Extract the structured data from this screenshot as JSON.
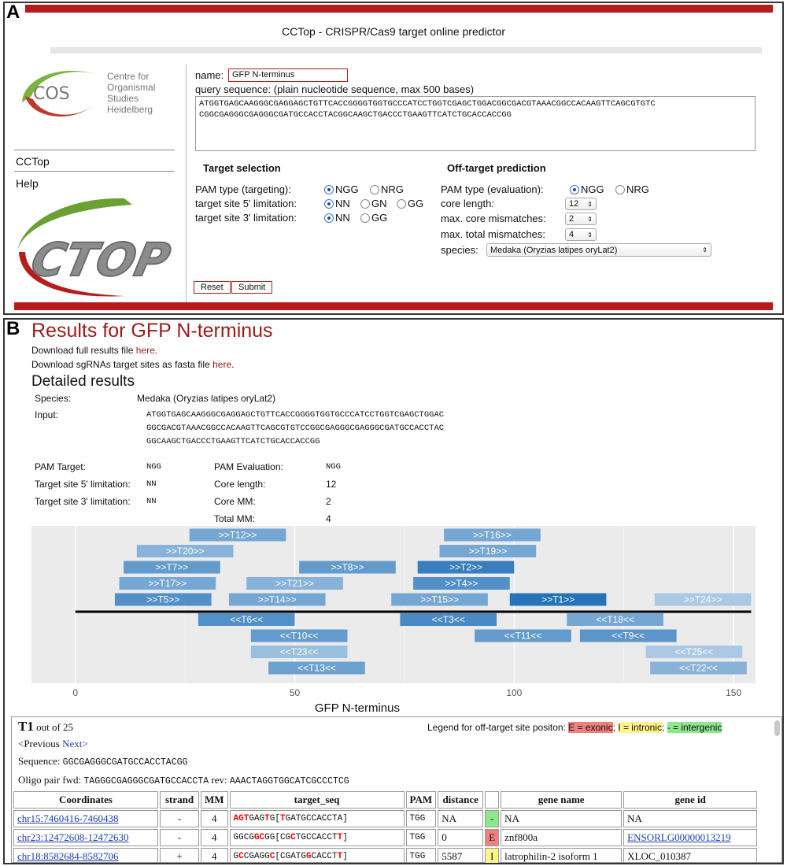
{
  "panel_a": {
    "label": "A",
    "app_title": "CCTop - CRISPR/Cas9 target online predictor",
    "logo_text": [
      "Centre for",
      "Organismal",
      "Studies",
      "Heidelberg"
    ],
    "logo_abbr": "COS",
    "cctop_logo": "CTOP",
    "sidebar": [
      "CCTop",
      "Help"
    ],
    "name_label": "name:",
    "name_value": "GFP N-terminus",
    "query_label": "query sequence: (plain nucleotide sequence, max 500 bases)",
    "query_value": "ATGGTGAGCAAGGGCGAGGAGCTGTTCACCGGGGTGGTGCCCATCCTGGTCGAGCTGGACGGCGACGTAAACGGCCACAAGTTCAGCGTGTC\nCGGCGAGGGCGAGGGCGATGCCACCTACGGCAAGCTGACCCTGAAGTTCATCTGCACCACCGG",
    "target_selection": {
      "heading": "Target selection",
      "pam_label": "PAM type (targeting):",
      "pam_options": [
        "NGG",
        "NRG"
      ],
      "five_label": "target site 5' limitation:",
      "five_options": [
        "NN",
        "GN",
        "GG"
      ],
      "three_label": "target site 3' limitation:",
      "three_options": [
        "NN",
        "GG"
      ]
    },
    "offtarget": {
      "heading": "Off-target prediction",
      "pam_label": "PAM type (evaluation):",
      "pam_options": [
        "NGG",
        "NRG"
      ],
      "core_label": "core length:",
      "core_value": "12",
      "core_mm_label": "max. core mismatches:",
      "core_mm_value": "2",
      "total_mm_label": "max. total mismatches:",
      "total_mm_value": "4",
      "species_label": "species:",
      "species_value": "Medaka (Oryzias latipes oryLat2)"
    },
    "reset_label": "Reset",
    "submit_label": "Submit"
  },
  "panel_b": {
    "label": "B",
    "title": "Results for GFP N-terminus",
    "download_full_prefix": "Download full results file ",
    "download_sg_prefix": "Download sgRNAs target sites as fasta file ",
    "here": "here",
    "period": ".",
    "detailed": "Detailed results",
    "species_label": "Species:",
    "species_value": "Medaka (Oryzias latipes oryLat2)",
    "input_label": "Input:",
    "input_lines": [
      "ATGGTGAGCAAGGGCGAGGAGCTGTTCACCGGGGTGGTGCCCATCCTGGTCGAGCTGGAC",
      "GGCGACGTAAACGGCCACAAGTTCAGCGTGTCCGGCGAGGGCGAGGGCGATGCCACCTAC",
      "GGCAAGCTGACCCTGAAGTTCATCTGCACCACCGG"
    ],
    "pam_target_label": "PAM Target:",
    "pam_target_value": "NGG",
    "five_label": "Target site 5' limitation:",
    "five_value": "NN",
    "three_label": "Target site 3' limitation:",
    "three_value": "NN",
    "pam_eval_label": "PAM Evaluation:",
    "pam_eval_value": "NGG",
    "core_label": "Core length:",
    "core_value": "12",
    "core_mm_label": "Core MM:",
    "core_mm_value": "2",
    "total_mm_label": "Total MM:",
    "total_mm_value": "4",
    "t1": {
      "title": "T1",
      "out_of": " out of 25",
      "legend_prefix": "Legend for off-target site positon: ",
      "legend_e": "E = exonic",
      "legend_i": "I = intronic",
      "legend_g": "- = intergenic",
      "prev": "<Previous",
      "next": "Next>",
      "seq_label": "Sequence: ",
      "seq_value": "GGCGAGGGCGATGCCACCTACGG",
      "oligo_label": "Oligo pair fwd: ",
      "oligo_fwd": "TAGGGCGAGGGCGATGCCACCTA",
      "oligo_rev_label": " rev: ",
      "oligo_rev": "AAACTAGGTGGCATCGCCCTCG",
      "columns": [
        "Coordinates",
        "strand",
        "MM",
        "target_seq",
        "PAM",
        "distance",
        "",
        "gene name",
        "gene id"
      ],
      "rows": [
        {
          "coord": "chr15:7460416-7460438",
          "strand": "-",
          "mm": "4",
          "seq": [
            [
              "AGT",
              "m"
            ],
            [
              "GAG",
              ""
            ],
            [
              "T",
              "m"
            ],
            [
              "G[",
              ""
            ],
            [
              "T",
              "m"
            ],
            [
              "GATGCCACCTA]",
              ""
            ]
          ],
          "pam": "TGG",
          "distance": "NA",
          "pos": "-",
          "pos_class": "g",
          "gene": "NA",
          "geneid": "NA",
          "geneid_link": false
        },
        {
          "coord": "chr23:12472608-12472630",
          "strand": "-",
          "mm": "4",
          "seq": [
            [
              "GGCG",
              ""
            ],
            [
              "GC",
              "m"
            ],
            [
              "GG[CG",
              ""
            ],
            [
              "C",
              "m"
            ],
            [
              "TGCCACCT",
              ""
            ],
            [
              "T",
              "m"
            ],
            [
              "]",
              ""
            ]
          ],
          "pam": "TGG",
          "distance": "0",
          "pos": "E",
          "pos_class": "e",
          "gene": "znf800a",
          "geneid": "ENSORLG00000013219",
          "geneid_link": true
        },
        {
          "coord": "chr18:8582684-8582706",
          "strand": "+",
          "mm": "4",
          "seq": [
            [
              "G",
              ""
            ],
            [
              "C",
              "m"
            ],
            [
              "CGAGG",
              ""
            ],
            [
              "C",
              "m"
            ],
            [
              "[CGATG",
              ""
            ],
            [
              "G",
              "m"
            ],
            [
              "CACCT",
              ""
            ],
            [
              "T",
              "m"
            ],
            [
              "]",
              ""
            ]
          ],
          "pam": "TGG",
          "distance": "5587",
          "pos": "I",
          "pos_class": "i",
          "gene": "latrophilin-2 isoform 1",
          "geneid": "XLOC_010387",
          "geneid_link": false
        }
      ]
    }
  },
  "chart_data": {
    "type": "bar",
    "xlabel": "GFP N-terminus",
    "xlim": [
      -10,
      155
    ],
    "xticks": [
      0,
      50,
      100,
      150
    ],
    "sequence_line": [
      0,
      154
    ],
    "targets": [
      {
        "name": ">>T12>>",
        "start": 26,
        "end": 48,
        "strand": "+",
        "row": 5,
        "score": 0.5
      },
      {
        "name": ">>T16>>",
        "start": 84,
        "end": 106,
        "strand": "+",
        "row": 5,
        "score": 0.5
      },
      {
        "name": ">>T20>>",
        "start": 14,
        "end": 36,
        "strand": "+",
        "row": 4,
        "score": 0.4
      },
      {
        "name": ">>T19>>",
        "start": 83,
        "end": 105,
        "strand": "+",
        "row": 4,
        "score": 0.5
      },
      {
        "name": ">>T7>>",
        "start": 11,
        "end": 33,
        "strand": "+",
        "row": 3,
        "score": 0.6
      },
      {
        "name": ">>T8>>",
        "start": 51,
        "end": 73,
        "strand": "+",
        "row": 3,
        "score": 0.6
      },
      {
        "name": ">>T2>>",
        "start": 78,
        "end": 100,
        "strand": "+",
        "row": 3,
        "score": 0.85
      },
      {
        "name": ">>T17>>",
        "start": 10,
        "end": 32,
        "strand": "+",
        "row": 2,
        "score": 0.5
      },
      {
        "name": ">>T21>>",
        "start": 39,
        "end": 61,
        "strand": "+",
        "row": 2,
        "score": 0.4
      },
      {
        "name": ">>T4>>",
        "start": 77,
        "end": 99,
        "strand": "+",
        "row": 2,
        "score": 0.7
      },
      {
        "name": ">>T5>>",
        "start": 9,
        "end": 31,
        "strand": "+",
        "row": 1,
        "score": 0.7
      },
      {
        "name": ">>T14>>",
        "start": 35,
        "end": 57,
        "strand": "+",
        "row": 1,
        "score": 0.5
      },
      {
        "name": ">>T15>>",
        "start": 72,
        "end": 94,
        "strand": "+",
        "row": 1,
        "score": 0.5
      },
      {
        "name": ">>T1>>",
        "start": 99,
        "end": 121,
        "strand": "+",
        "row": 1,
        "score": 0.95
      },
      {
        "name": ">>T24>>",
        "start": 132,
        "end": 154,
        "strand": "+",
        "row": 1,
        "score": 0.2
      },
      {
        "name": "<<T6<<",
        "start": 28,
        "end": 50,
        "strand": "-",
        "row": 1,
        "score": 0.7
      },
      {
        "name": "<<T3<<",
        "start": 74,
        "end": 96,
        "strand": "-",
        "row": 1,
        "score": 0.75
      },
      {
        "name": "<<T18<<",
        "start": 112,
        "end": 134,
        "strand": "-",
        "row": 1,
        "score": 0.5
      },
      {
        "name": "<<T10<<",
        "start": 40,
        "end": 62,
        "strand": "-",
        "row": 2,
        "score": 0.6
      },
      {
        "name": "<<T11<<",
        "start": 91,
        "end": 113,
        "strand": "-",
        "row": 2,
        "score": 0.6
      },
      {
        "name": "<<T9<<",
        "start": 115,
        "end": 137,
        "strand": "-",
        "row": 2,
        "score": 0.65
      },
      {
        "name": "<<T23<<",
        "start": 40,
        "end": 62,
        "strand": "-",
        "row": 3,
        "score": 0.3
      },
      {
        "name": "<<T25<<",
        "start": 130,
        "end": 152,
        "strand": "-",
        "row": 3,
        "score": 0.2
      },
      {
        "name": "<<T13<<",
        "start": 44,
        "end": 66,
        "strand": "-",
        "row": 4,
        "score": 0.55
      },
      {
        "name": "<<T22<<",
        "start": 131,
        "end": 153,
        "strand": "-",
        "row": 4,
        "score": 0.4
      }
    ]
  },
  "colors": {
    "brand_red": "#b71c1c",
    "title_red": "#9b1b1b",
    "bar_dark": "#1d6db5",
    "bar_light": "#cfe0f0",
    "plot_bg": "#ebebeb"
  }
}
